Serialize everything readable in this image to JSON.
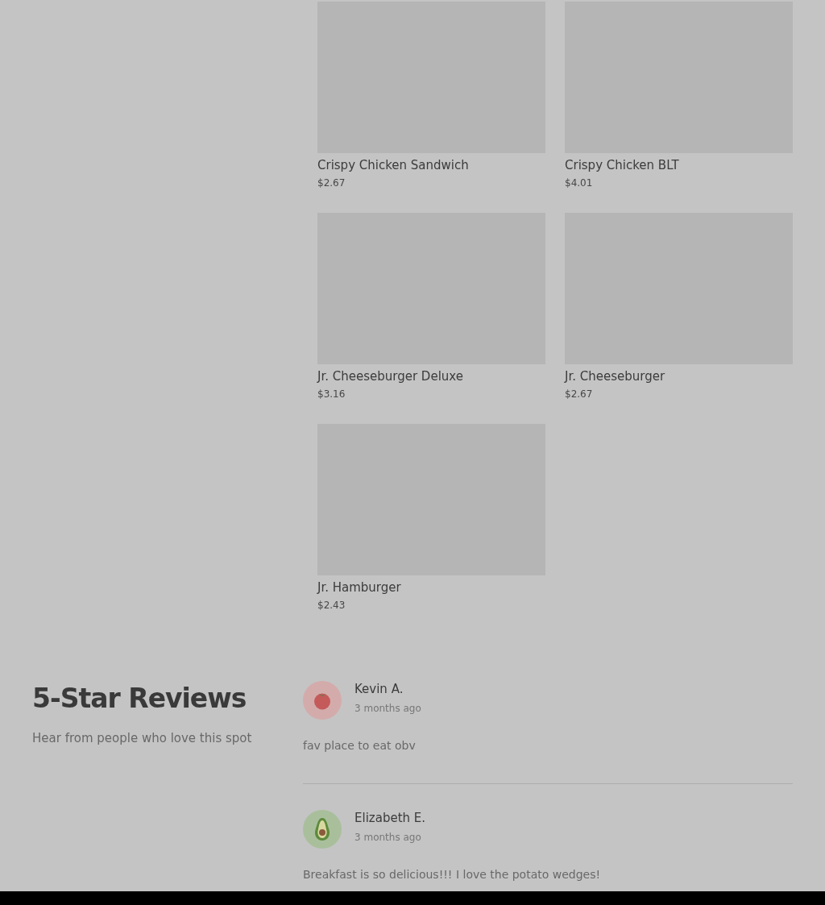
{
  "menu_items": [
    {
      "name": "Crispy Chicken Sandwich",
      "price": "$2.67"
    },
    {
      "name": "Crispy Chicken BLT",
      "price": "$4.01"
    },
    {
      "name": "Jr. Cheeseburger Deluxe",
      "price": "$3.16"
    },
    {
      "name": "Jr. Cheeseburger",
      "price": "$2.67"
    },
    {
      "name": "Jr. Hamburger",
      "price": "$2.43"
    }
  ],
  "reviews_section": {
    "title": "5-Star Reviews",
    "subtitle": "Hear from people who love this spot"
  },
  "reviews": [
    {
      "author": "Kevin A.",
      "time": "3 months ago",
      "text": "fav place to eat obv",
      "color": "#d4abab"
    },
    {
      "author": "Elizabeth E.",
      "time": "3 months ago",
      "text": "Breakfast is so delicious!!! I love the potato wedges!",
      "color": "#a9bf9c"
    }
  ]
}
